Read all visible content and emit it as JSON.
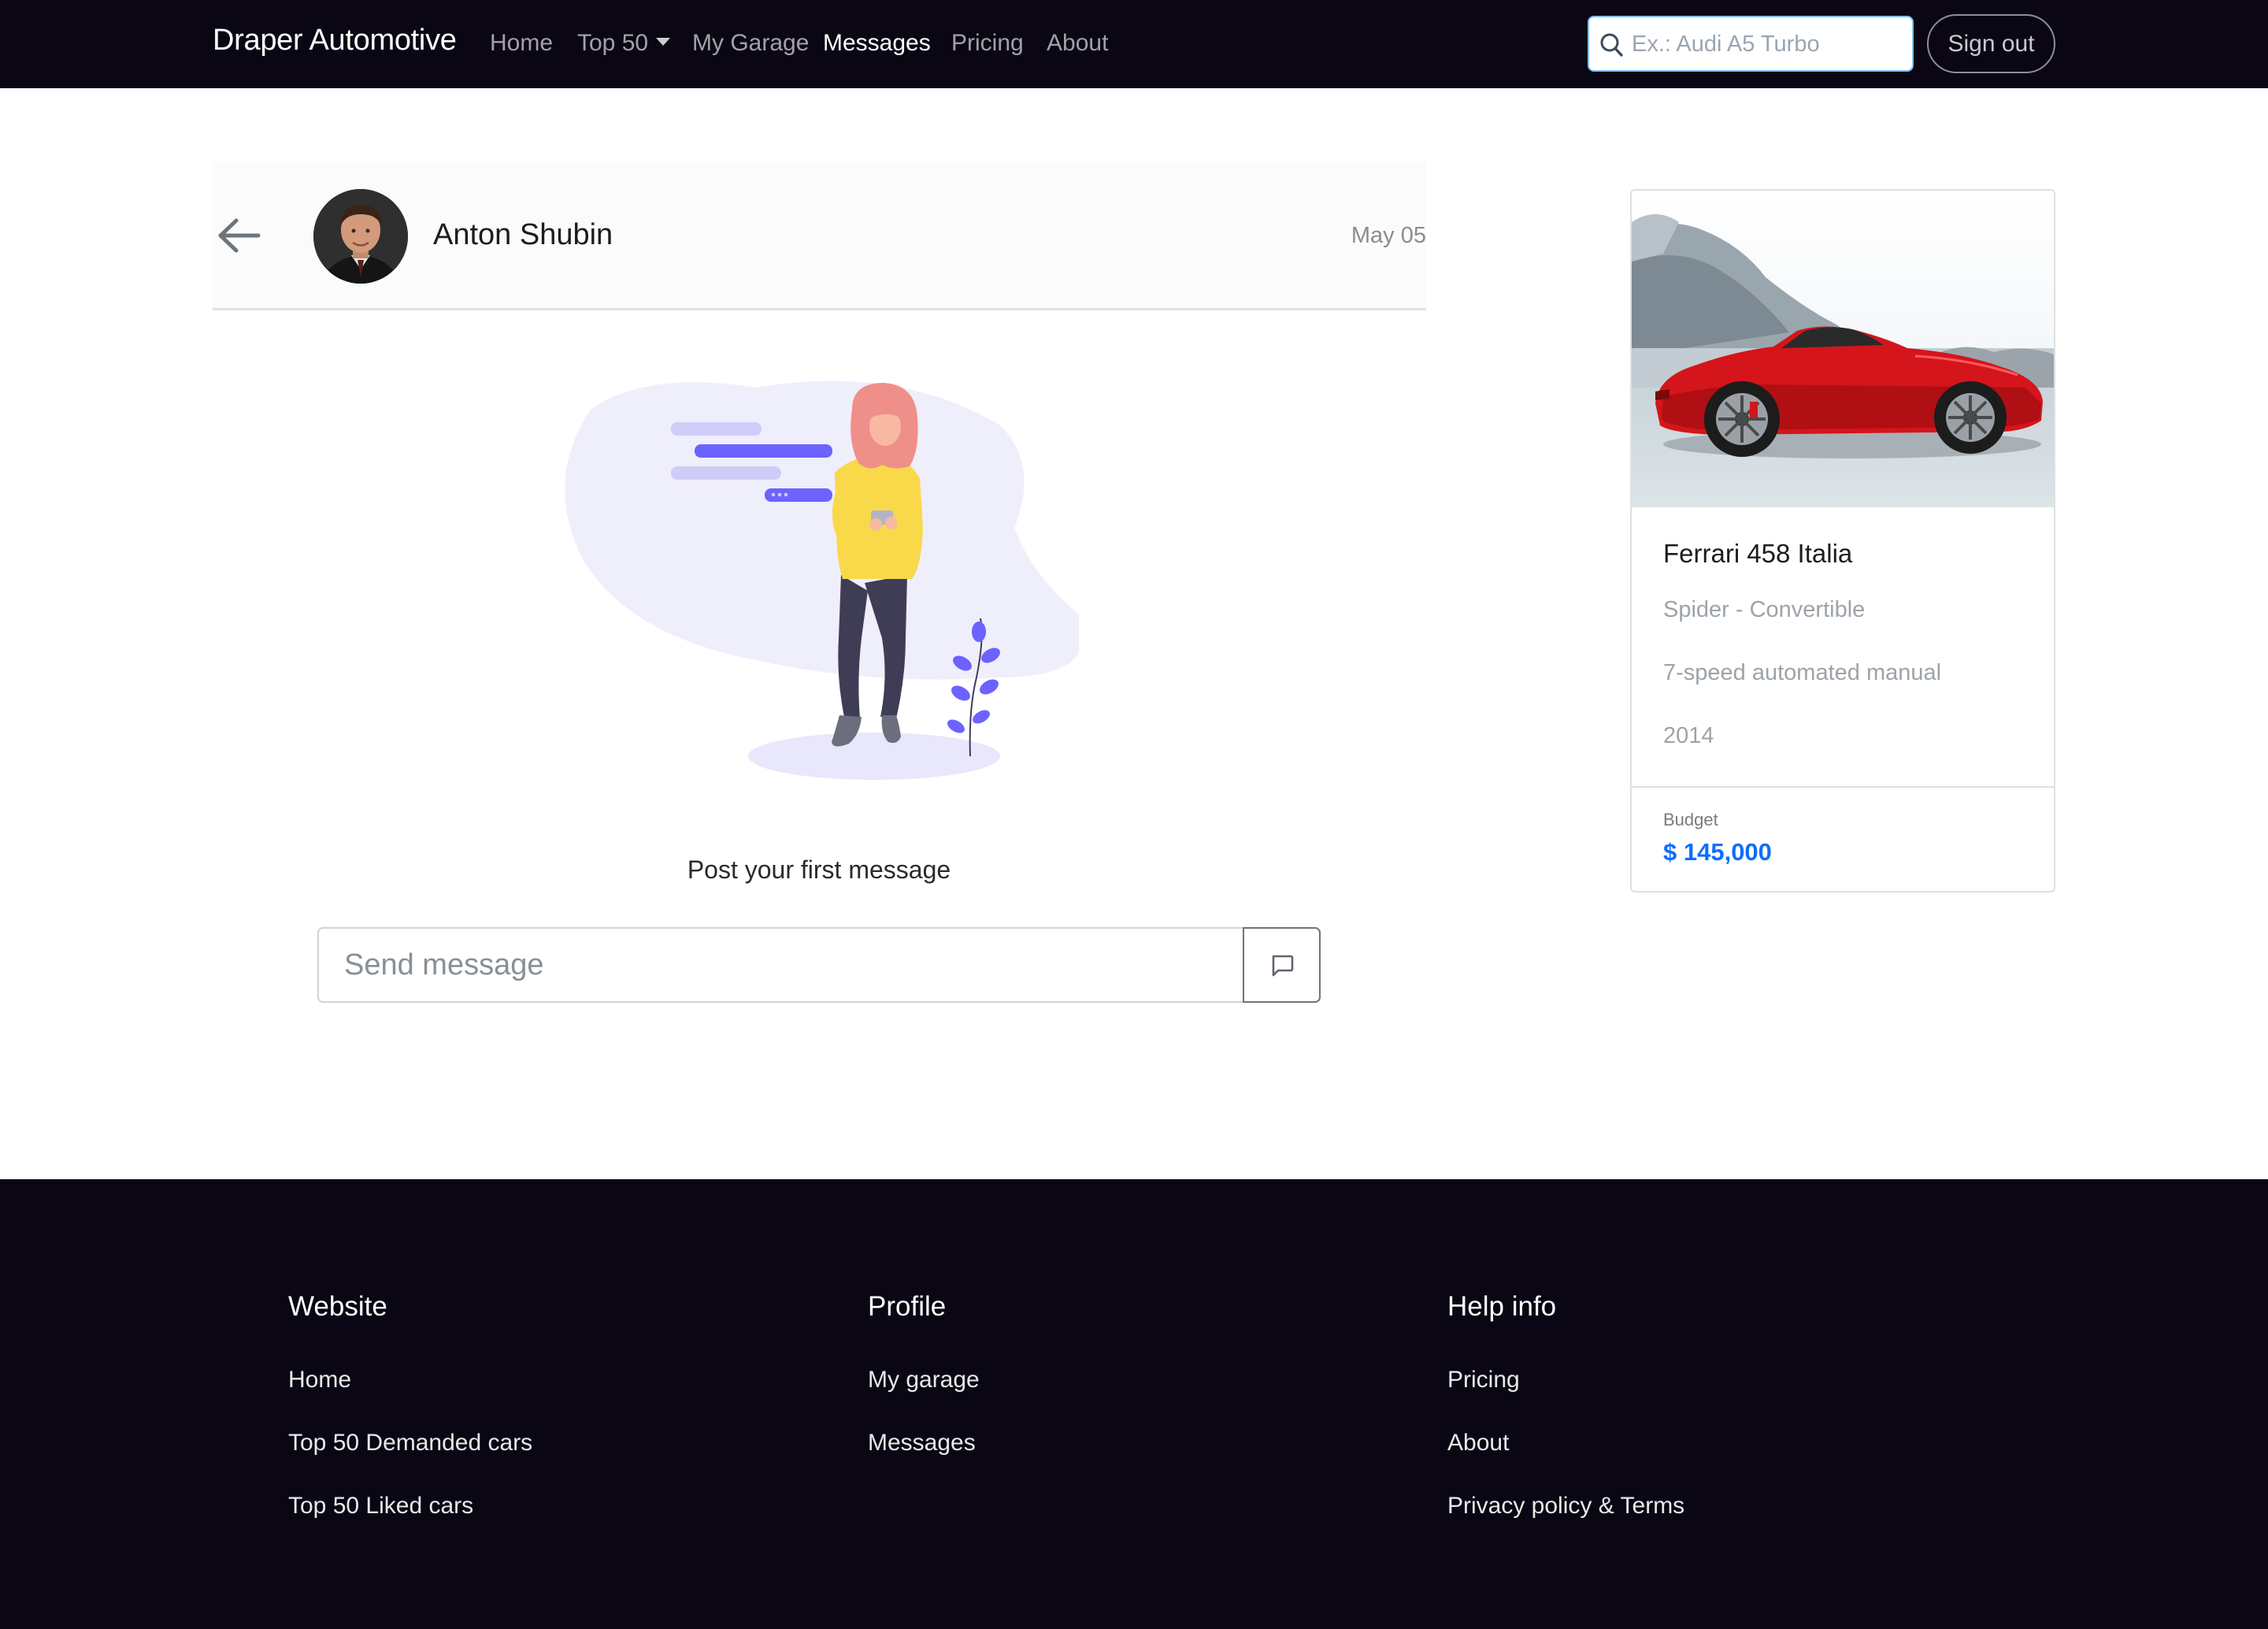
{
  "navbar": {
    "brand": "Draper Automotive",
    "links": {
      "home": "Home",
      "top50": "Top 50",
      "garage": "My Garage",
      "messages": "Messages",
      "pricing": "Pricing",
      "about": "About"
    },
    "search_placeholder": "Ex.: Audi A5 Turbo",
    "signout": "Sign out"
  },
  "chat": {
    "contact_name": "Anton Shubin",
    "date": "May 05",
    "empty_text": "Post your first message",
    "input_placeholder": "Send message"
  },
  "car": {
    "name": "Ferrari 458 Italia",
    "body": "Spider - Convertible",
    "transmission": "7-speed automated manual",
    "year": "2014",
    "budget_label": "Budget",
    "budget_value": "$ 145,000"
  },
  "footer": {
    "website": {
      "heading": "Website",
      "links": [
        "Home",
        "Top 50 Demanded cars",
        "Top 50 Liked cars"
      ]
    },
    "profile": {
      "heading": "Profile",
      "links": [
        "My garage",
        "Messages"
      ]
    },
    "help": {
      "heading": "Help info",
      "links": [
        "Pricing",
        "About",
        "Privacy policy & Terms"
      ]
    }
  },
  "colors": {
    "navbar_bg": "#0b0614",
    "accent_blue": "#0d6efd",
    "illustration_purple": "#6c63ff",
    "illustration_yellow": "#f9d94a",
    "car_red": "#d4151b"
  },
  "icons": {
    "search": "search-icon",
    "back": "arrow-left-icon",
    "send": "chat-bubble-icon",
    "caret": "chevron-down-icon"
  }
}
